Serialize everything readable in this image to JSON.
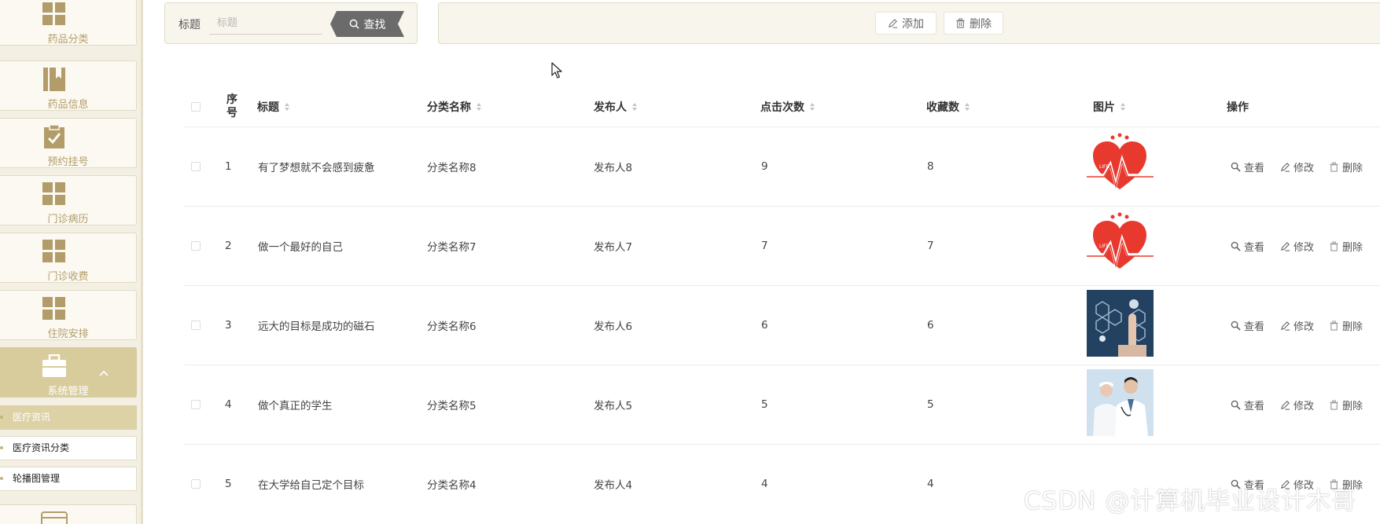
{
  "sidebar": {
    "items": [
      {
        "label": "药品分类",
        "icon": "grid-icon"
      },
      {
        "label": "药品信息",
        "icon": "book-icon"
      },
      {
        "label": "预约挂号",
        "icon": "clipboard-check-icon"
      },
      {
        "label": "门诊病历",
        "icon": "grid-icon"
      },
      {
        "label": "门诊收费",
        "icon": "grid-icon"
      },
      {
        "label": "住院安排",
        "icon": "grid-icon"
      },
      {
        "label": "系统管理",
        "icon": "briefcase-icon"
      }
    ],
    "sub_items": [
      {
        "label": "医疗资讯"
      },
      {
        "label": "医疗资讯分类"
      },
      {
        "label": "轮播图管理"
      }
    ]
  },
  "search": {
    "label": "标题",
    "placeholder": "标题",
    "value": "",
    "button_label": "查找"
  },
  "actions": {
    "add_label": "添加",
    "delete_label": "删除"
  },
  "table": {
    "headers": {
      "index": "序号",
      "title": "标题",
      "category": "分类名称",
      "publisher": "发布人",
      "clicks": "点击次数",
      "favorites": "收藏数",
      "image": "图片",
      "operations": "操作"
    },
    "rows": [
      {
        "index": "1",
        "title": "有了梦想就不会感到疲惫",
        "category": "分类名称8",
        "publisher": "发布人8",
        "clicks": "9",
        "favorites": "8",
        "image": "heart-ecg"
      },
      {
        "index": "2",
        "title": "做一个最好的自己",
        "category": "分类名称7",
        "publisher": "发布人7",
        "clicks": "7",
        "favorites": "7",
        "image": "heart-ecg"
      },
      {
        "index": "3",
        "title": "远大的目标是成功的磁石",
        "category": "分类名称6",
        "publisher": "发布人6",
        "clicks": "6",
        "favorites": "6",
        "image": "medical-tech"
      },
      {
        "index": "4",
        "title": "做个真正的学生",
        "category": "分类名称5",
        "publisher": "发布人5",
        "clicks": "5",
        "favorites": "5",
        "image": "doctors"
      },
      {
        "index": "5",
        "title": "在大学给自己定个目标",
        "category": "分类名称4",
        "publisher": "发布人4",
        "clicks": "4",
        "favorites": "4",
        "image": ""
      }
    ],
    "row_ops": {
      "view": "查看",
      "edit": "修改",
      "delete": "删除"
    }
  },
  "watermark": "CSDN @计算机毕业设计木哥",
  "colors": {
    "sidebar_bg": "#f3efe3",
    "sidebar_text": "#b29d6a",
    "sidebar_active": "#d8cc9d",
    "search_button": "#6b6b6b",
    "panel_bg": "#f7f5ec"
  }
}
